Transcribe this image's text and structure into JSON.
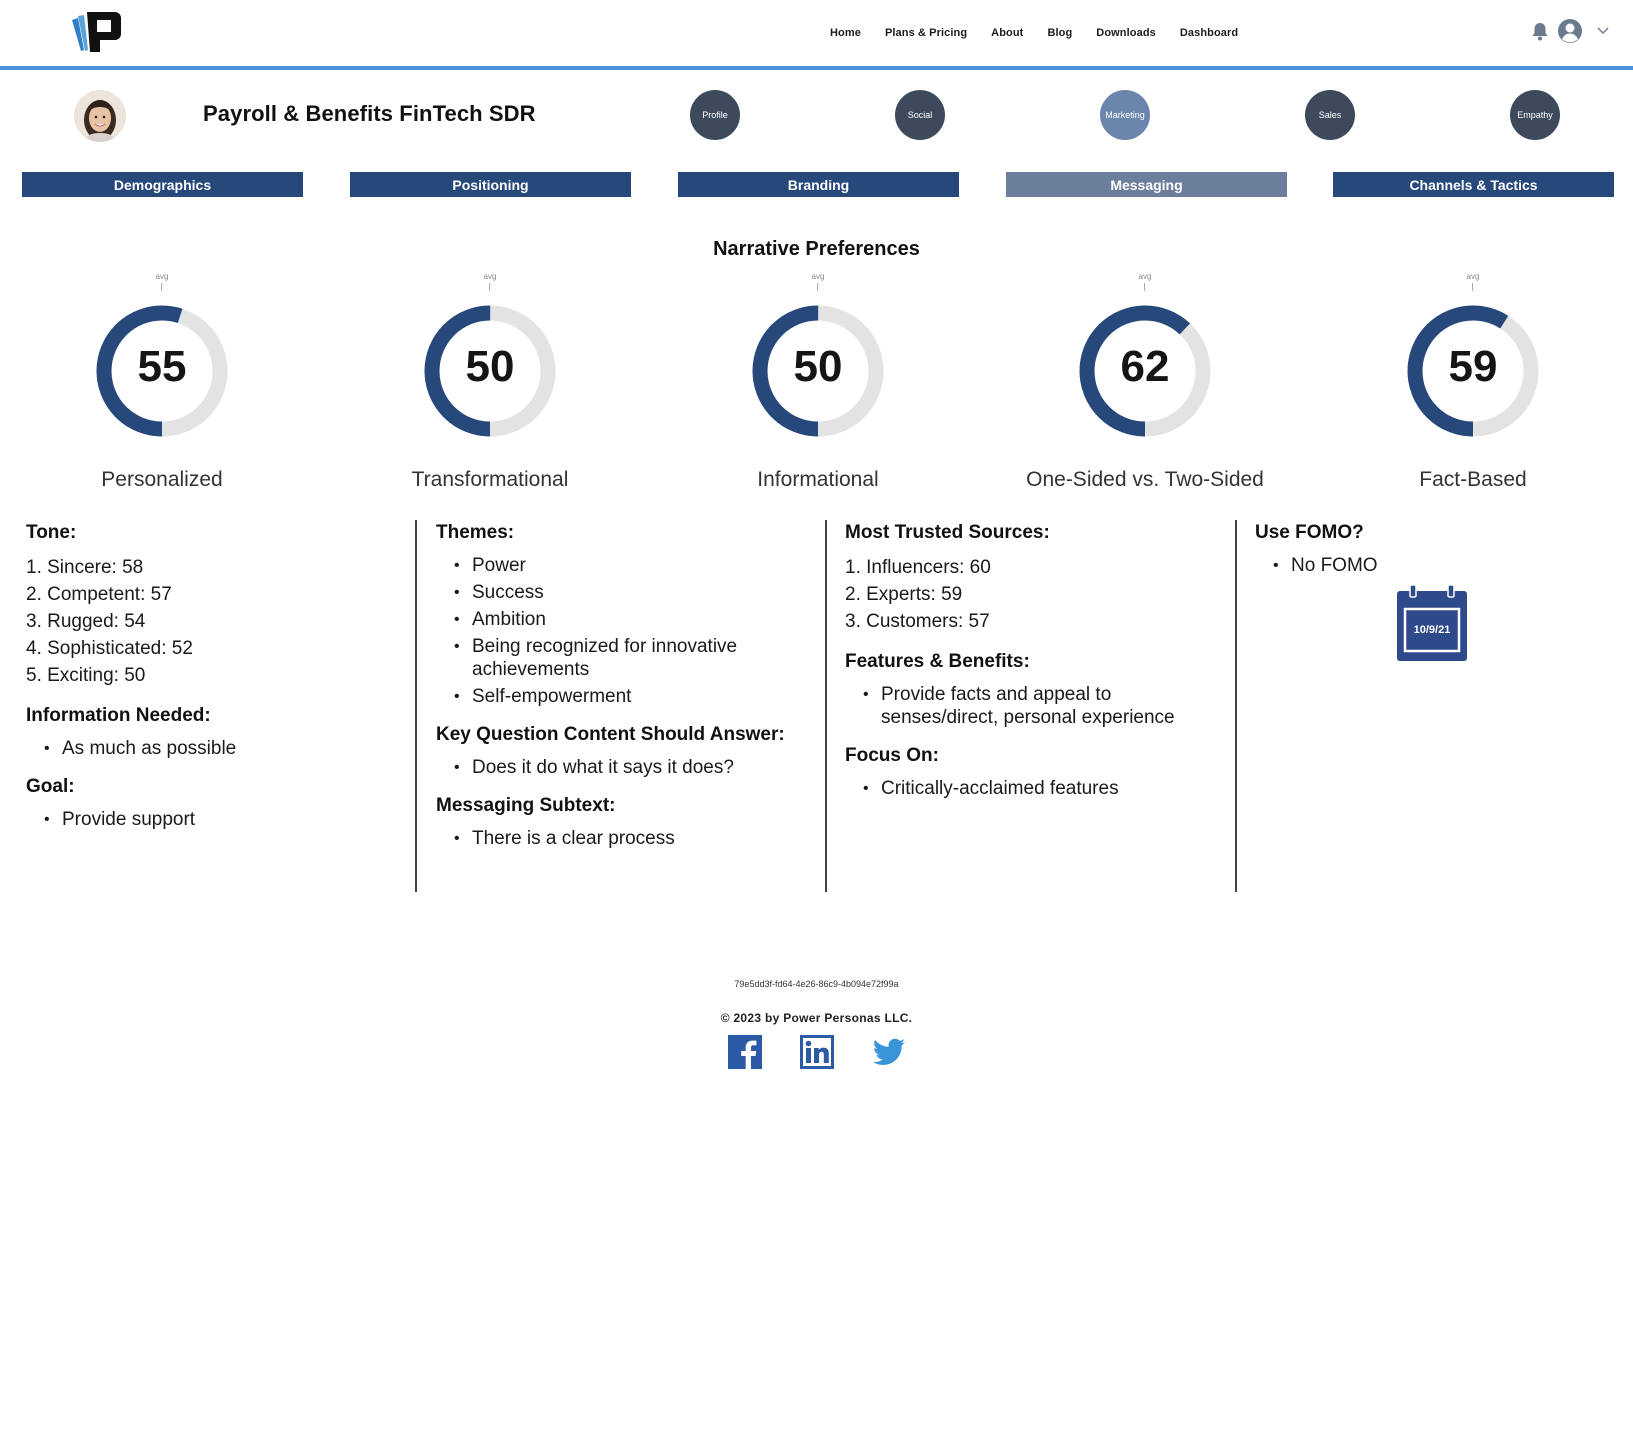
{
  "nav": {
    "items": [
      "Home",
      "Plans & Pricing",
      "About",
      "Blog",
      "Downloads",
      "Dashboard"
    ]
  },
  "persona": {
    "title": "Payroll & Benefits FinTech SDR"
  },
  "circle_buttons": [
    {
      "label": "Profile",
      "active": false
    },
    {
      "label": "Social",
      "active": false
    },
    {
      "label": "Marketing",
      "active": true
    },
    {
      "label": "Sales",
      "active": false
    },
    {
      "label": "Empathy",
      "active": false
    }
  ],
  "tabs": [
    {
      "label": "Demographics",
      "active": false
    },
    {
      "label": "Positioning",
      "active": false
    },
    {
      "label": "Branding",
      "active": false
    },
    {
      "label": "Messaging",
      "active": true
    },
    {
      "label": "Channels & Tactics",
      "active": false
    }
  ],
  "section_title": "Narrative Preferences",
  "gauges": [
    {
      "avg_label": "avg",
      "value": "55",
      "label": "Personalized",
      "fraction": 0.55
    },
    {
      "avg_label": "avg",
      "value": "50",
      "label": "Transformational",
      "fraction": 0.5
    },
    {
      "avg_label": "avg",
      "value": "50",
      "label": "Informational",
      "fraction": 0.5
    },
    {
      "avg_label": "avg",
      "value": "62",
      "label": "One-Sided vs. Two-Sided",
      "fraction": 0.62
    },
    {
      "avg_label": "avg",
      "value": "59",
      "label": "Fact-Based",
      "fraction": 0.59
    }
  ],
  "col1": {
    "tone_heading": "Tone:",
    "tone_items": [
      "1. Sincere: 58",
      "2. Competent: 57",
      "3. Rugged: 54",
      "4. Sophisticated: 52",
      "5. Exciting: 50"
    ],
    "info_heading": "Information Needed:",
    "info_items": [
      "As much as possible"
    ],
    "goal_heading": "Goal:",
    "goal_items": [
      "Provide support"
    ]
  },
  "col2": {
    "themes_heading": "Themes:",
    "themes_items": [
      "Power",
      "Success",
      "Ambition",
      "Being recognized for innovative achievements",
      "Self-empowerment"
    ],
    "kq_heading": "Key Question Content Should Answer:",
    "kq_items": [
      "Does it do what it says it does?"
    ],
    "subtext_heading": "Messaging Subtext:",
    "subtext_items": [
      "There is a clear process"
    ]
  },
  "col3": {
    "sources_heading": "Most Trusted Sources:",
    "sources_items": [
      "1. Influencers: 60",
      "2. Experts: 59",
      "3. Customers: 57"
    ],
    "fb_heading": "Features & Benefits:",
    "fb_items": [
      "Provide facts and appeal to senses/direct, personal experience"
    ],
    "focus_heading": "Focus On:",
    "focus_items": [
      "Critically-acclaimed features"
    ]
  },
  "col4": {
    "fomo_heading": "Use FOMO?",
    "fomo_items": [
      "No FOMO"
    ],
    "calendar_date": "10/9/21"
  },
  "footer": {
    "id": "79e5dd3f-fd64-4e26-86c9-4b094e72f99a",
    "copyright": "© 2023 by Power Personas LLC."
  },
  "colors": {
    "accent_bar": "#4a90d9",
    "tab_bg": "#26487a",
    "tab_active_bg": "#6b7f9c",
    "circle_btn": "#3d4a5c",
    "circle_btn_active": "#6b85ad",
    "gauge_fill": "#26487a",
    "gauge_track": "#e3e3e3",
    "calendar": "#2f4a8a"
  }
}
